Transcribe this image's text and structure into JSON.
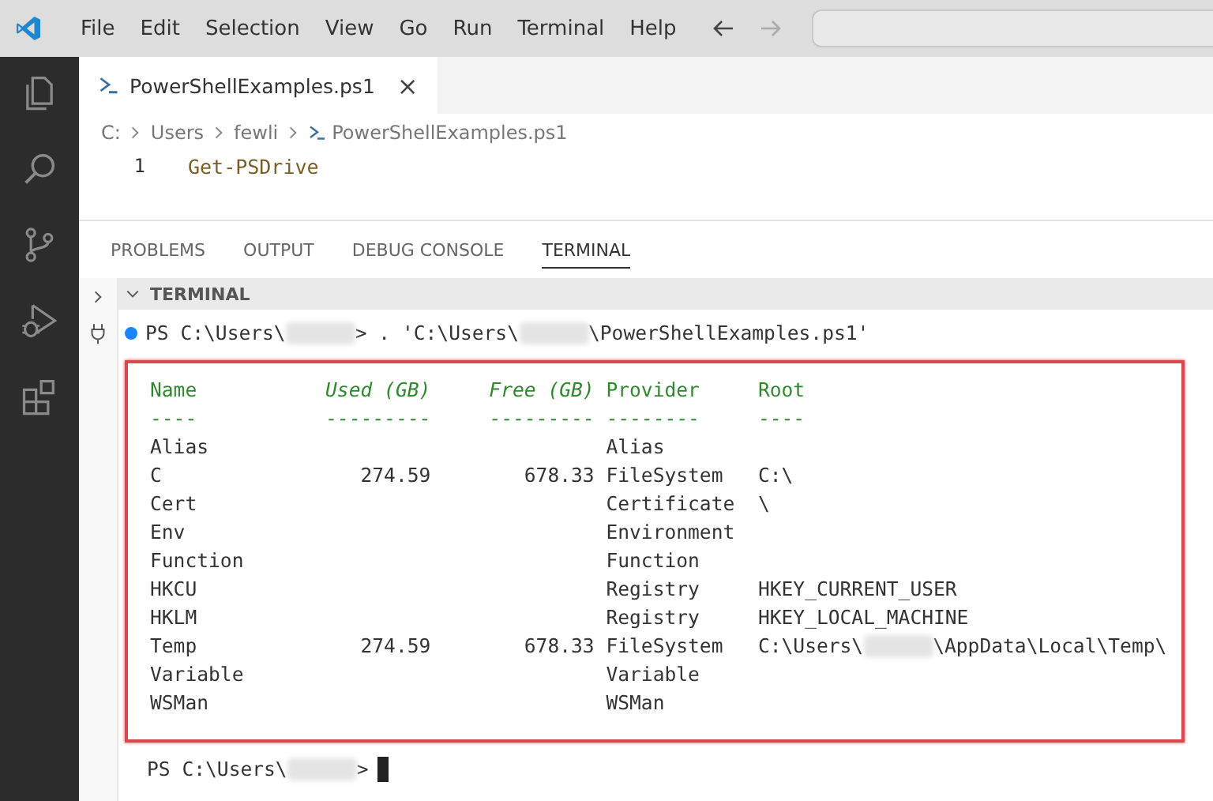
{
  "menu": [
    "File",
    "Edit",
    "Selection",
    "View",
    "Go",
    "Run",
    "Terminal",
    "Help"
  ],
  "activity_bar": [
    {
      "kind": "explorer",
      "selected": false
    },
    {
      "kind": "search",
      "selected": false
    },
    {
      "kind": "source-control",
      "selected": false
    },
    {
      "kind": "run-debug",
      "selected": false
    },
    {
      "kind": "extensions",
      "selected": false
    }
  ],
  "editor_tab": {
    "label": "PowerShellExamples.ps1",
    "close": "×"
  },
  "breadcrumbs": [
    "C:",
    "Users",
    "fewli",
    "PowerShellExamples.ps1"
  ],
  "code": [
    {
      "line": "1",
      "text": "Get-PSDrive"
    }
  ],
  "panel_tabs": [
    {
      "label": "PROBLEMS",
      "selected": false
    },
    {
      "label": "OUTPUT",
      "selected": false
    },
    {
      "label": "DEBUG CONSOLE",
      "selected": false
    },
    {
      "label": "TERMINAL",
      "selected": true
    }
  ],
  "terminal_header": "TERMINAL",
  "command_line": [
    {
      "kind": "text",
      "text": "PS C:\\Users\\"
    },
    {
      "kind": "redacted"
    },
    {
      "kind": "text",
      "text": "> . 'C:\\Users\\"
    },
    {
      "kind": "redacted"
    },
    {
      "kind": "text",
      "text": "\\PowerShellExamples.ps1'"
    }
  ],
  "table": {
    "columns": [
      "Name",
      "Used (GB)",
      "Free (GB)",
      "Provider",
      "Root"
    ],
    "underlines": [
      "----",
      "---------",
      "---------",
      "--------",
      "----"
    ],
    "rows": [
      {
        "name": "Alias",
        "provider": "Alias"
      },
      {
        "name": "C",
        "used": "274.59",
        "free": "678.33",
        "provider": "FileSystem",
        "root": [
          {
            "kind": "text",
            "text": "C:\\"
          }
        ]
      },
      {
        "name": "Cert",
        "provider": "Certificate",
        "root": [
          {
            "kind": "text",
            "text": "\\"
          }
        ]
      },
      {
        "name": "Env",
        "provider": "Environment"
      },
      {
        "name": "Function",
        "provider": "Function"
      },
      {
        "name": "HKCU",
        "provider": "Registry",
        "root": [
          {
            "kind": "text",
            "text": "HKEY_CURRENT_USER"
          }
        ]
      },
      {
        "name": "HKLM",
        "provider": "Registry",
        "root": [
          {
            "kind": "text",
            "text": "HKEY_LOCAL_MACHINE"
          }
        ]
      },
      {
        "name": "Temp",
        "used": "274.59",
        "free": "678.33",
        "provider": "FileSystem",
        "root": [
          {
            "kind": "text",
            "text": "C:\\Users\\"
          },
          {
            "kind": "redacted"
          },
          {
            "kind": "text",
            "text": "\\AppData\\Local\\Temp\\"
          }
        ]
      },
      {
        "name": "Variable",
        "provider": "Variable"
      },
      {
        "name": "WSMan",
        "provider": "WSMan"
      }
    ]
  },
  "prompt": [
    {
      "kind": "text",
      "text": "PS C:\\Users\\"
    },
    {
      "kind": "redacted"
    },
    {
      "kind": "text",
      "text": ">"
    }
  ]
}
